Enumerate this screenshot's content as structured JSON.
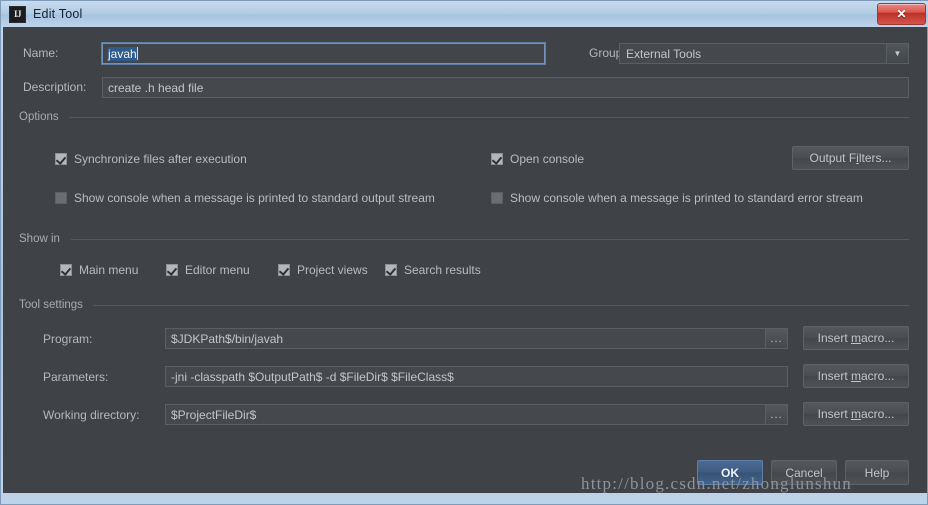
{
  "window": {
    "title": "Edit Tool",
    "app_icon": "intellij-idea-icon",
    "close_label": "✕"
  },
  "form": {
    "name_label": "Name:",
    "name_value": "javah",
    "group_label": "Group:",
    "group_value": "External Tools",
    "description_label": "Description:",
    "description_value": "create .h head file"
  },
  "options": {
    "title": "Options",
    "items": [
      {
        "label": "Synchronize files after execution",
        "checked": true
      },
      {
        "label": "Open console",
        "checked": true
      },
      {
        "label": "Show console when a message is printed to standard output stream",
        "checked": false
      },
      {
        "label": "Show console when a message is printed to standard error stream",
        "checked": false
      }
    ],
    "output_filters_button": "Output Filters..."
  },
  "show_in": {
    "title": "Show in",
    "items": [
      {
        "label": "Main menu",
        "checked": true
      },
      {
        "label": "Editor menu",
        "checked": true
      },
      {
        "label": "Project views",
        "checked": true
      },
      {
        "label": "Search results",
        "checked": true
      }
    ]
  },
  "tool_settings": {
    "title": "Tool settings",
    "program_label": "Program:",
    "program_value": "$JDKPath$/bin/javah",
    "parameters_label": "Parameters:",
    "parameters_value": "-jni -classpath $OutputPath$ -d $FileDir$ $FileClass$",
    "working_dir_label": "Working directory:",
    "working_dir_value": "$ProjectFileDir$",
    "browse_label": "...",
    "insert_macro_button": "Insert macro..."
  },
  "footer": {
    "ok": "OK",
    "cancel": "Cancel",
    "help": "Help"
  },
  "watermark": "http://blog.csdn.net/zhonglunshun"
}
